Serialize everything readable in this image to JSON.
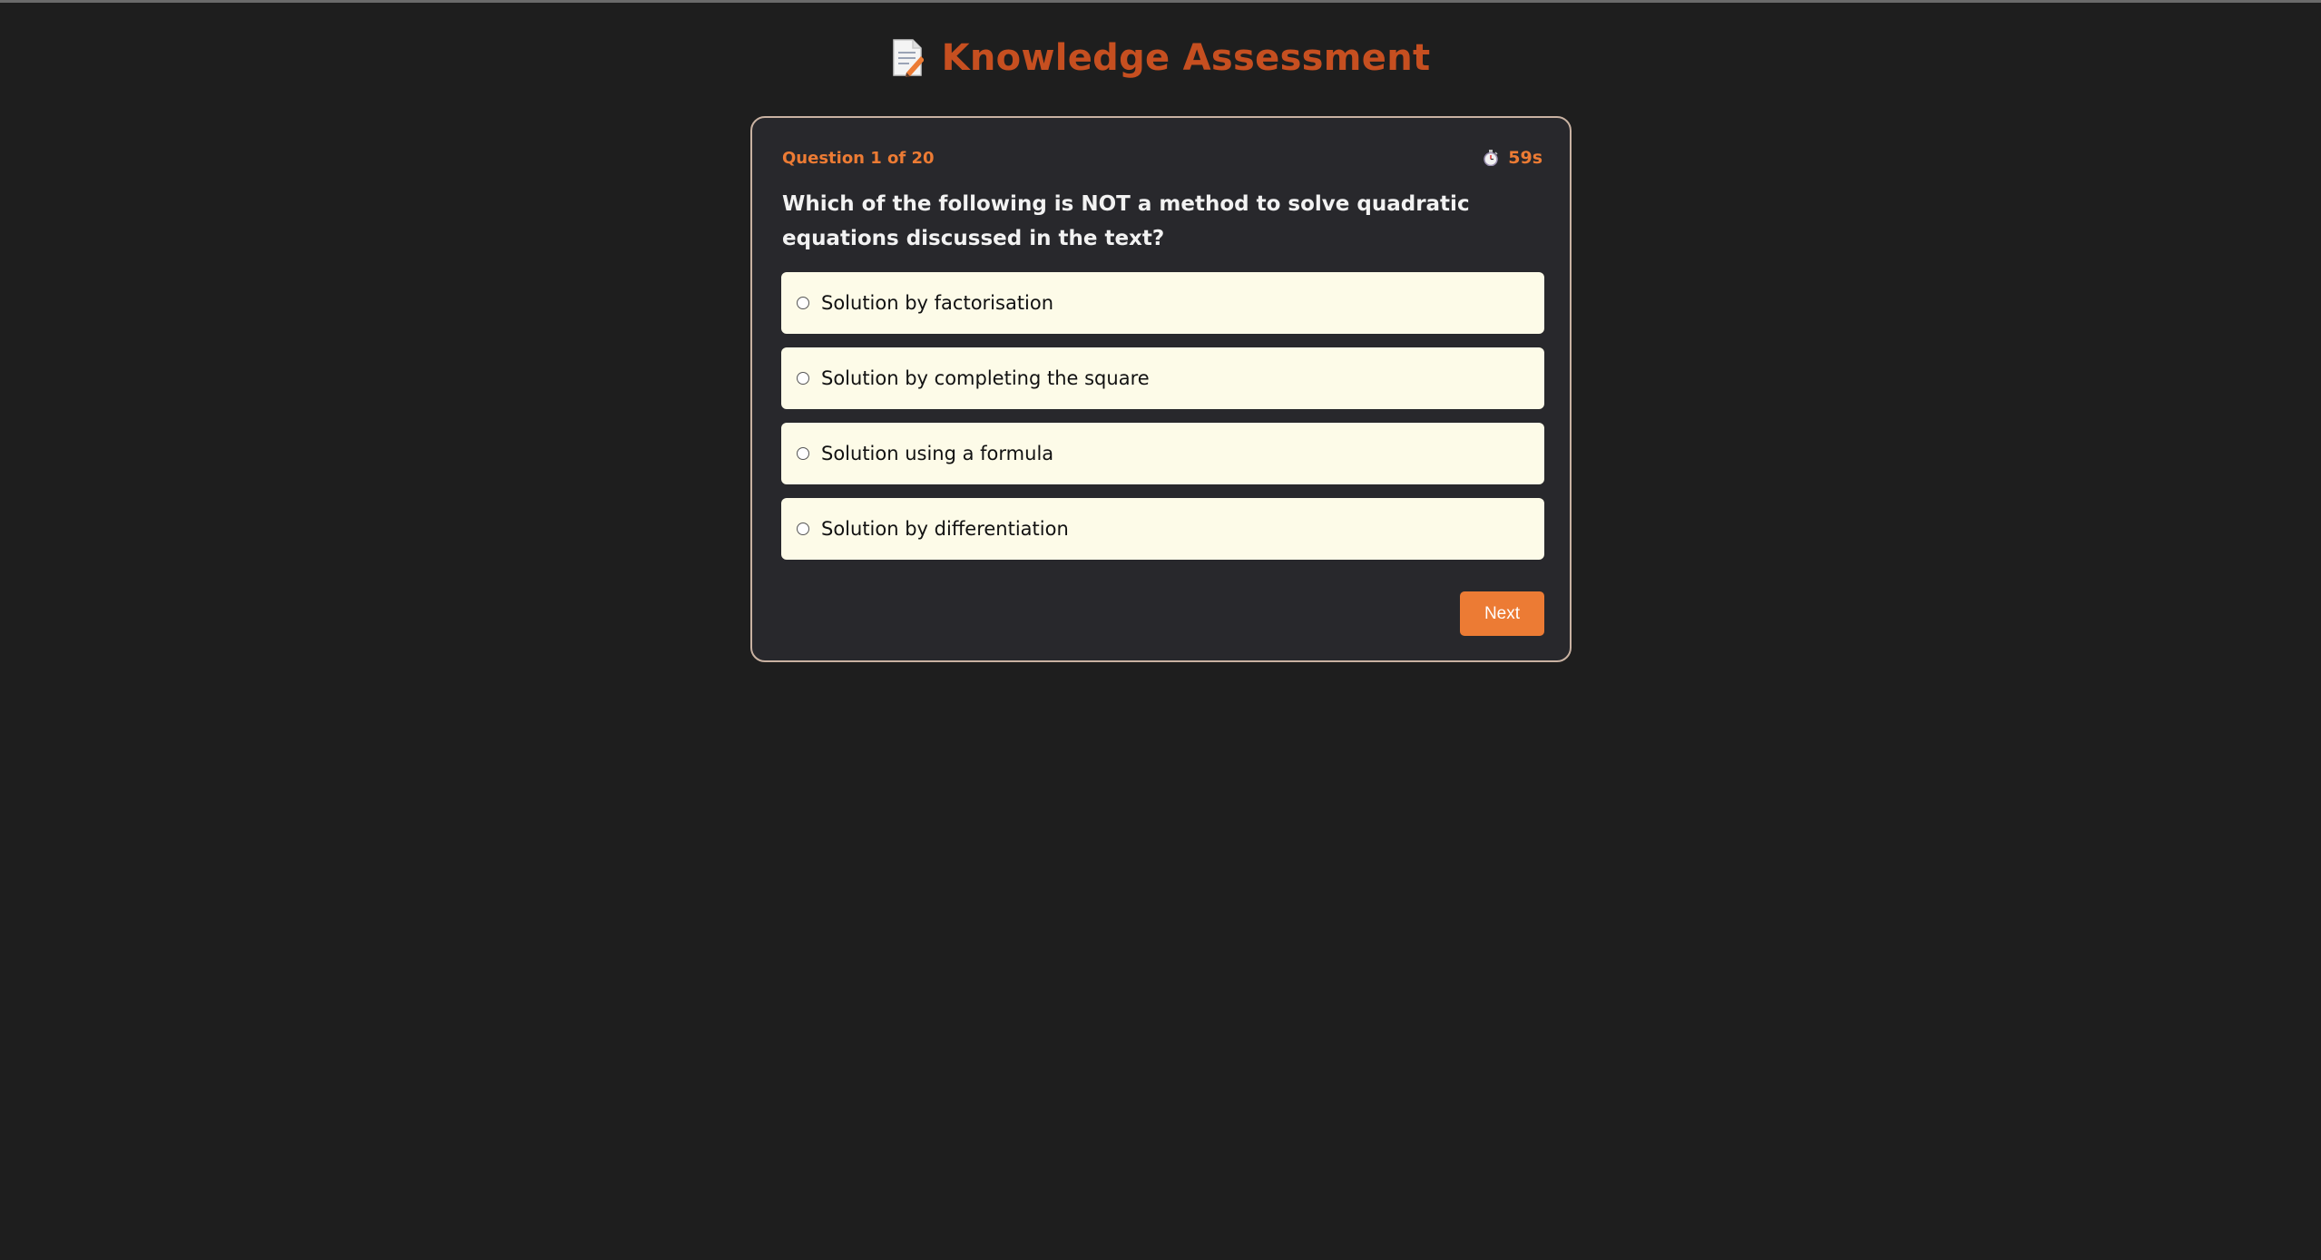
{
  "header": {
    "title": "Knowledge Assessment",
    "icon": "memo-icon"
  },
  "quiz": {
    "progress": "Question 1 of 20",
    "timer": {
      "icon": "stopwatch-icon",
      "value": "59s"
    },
    "question": "Which of the following is NOT a method to solve quadratic equations discussed in the text?",
    "options": [
      {
        "label": "Solution by factorisation",
        "selected": false
      },
      {
        "label": "Solution by completing the square",
        "selected": false
      },
      {
        "label": "Solution using a formula",
        "selected": false
      },
      {
        "label": "Solution by differentiation",
        "selected": false
      }
    ],
    "next_label": "Next"
  },
  "colors": {
    "background": "#1e1e1e",
    "card": "#28282c",
    "accent": "#ec7b34",
    "title": "#c64f20",
    "option_bg": "#fdfbe8"
  }
}
